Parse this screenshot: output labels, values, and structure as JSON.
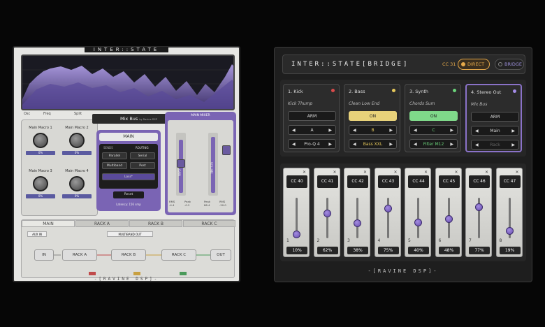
{
  "left": {
    "brand": "INTER::STATE",
    "spectrum_opts": [
      "Osc",
      "Freq",
      "Split"
    ],
    "mixbus": "Mix Bus",
    "mixbus_by": "by Ravine DSP",
    "macros": [
      "Main Macro 1",
      "Main Macro 2",
      "Main Macro 3",
      "Main Macro 4"
    ],
    "macro_vals": [
      "0%",
      "0%",
      "0%",
      "0%"
    ],
    "main_title": "MAIN",
    "mode_labels": [
      "SENDS",
      "ROUTING"
    ],
    "routing_btns": [
      "Parallel",
      "Serial",
      "Multiband",
      "Post"
    ],
    "loss_label": "Loss*",
    "reset": "Reset",
    "latency": "Latency: 156 smp",
    "mixer_title": "MAIN MIXER",
    "fader_labels": [
      "GAIN",
      "VOLUME"
    ],
    "meter_labels": [
      "RMS",
      "Peak",
      "Peak",
      "RMS"
    ],
    "meter_vals": [
      "-4.4",
      "-0.2",
      "86.4",
      "-20.0"
    ],
    "meter_knob_vals": [
      "0.0",
      "0.0"
    ],
    "tabs": [
      "MAIN",
      "RACK A",
      "RACK B",
      "RACK C"
    ],
    "main_mode": "AUX IN",
    "multiband": "MULTIBAND OUT",
    "chain": [
      "IN",
      "RACK A",
      "RACK B",
      "RACK C",
      "OUT"
    ],
    "footer": "-[RAVINE DSP]-",
    "colors": {
      "accent": "#5a5aa0",
      "purple": "#7a64b4"
    }
  },
  "right": {
    "brand": "INTER::STATE[BRIDGE]",
    "cc": "CC 31",
    "direct": "DIRECT",
    "bridge": "BRIDGE",
    "slots": [
      {
        "num_name": "1. Kick",
        "sub": "Kick Thump",
        "arm": "ARM",
        "arm_on": false,
        "mode": "A",
        "mode_color": "#ddd",
        "plugin": "Pro-Q 4",
        "plugin_color": "#ddd",
        "led": "#d94b4b"
      },
      {
        "num_name": "2. Bass",
        "sub": "Clean Low End",
        "arm": "ON",
        "arm_on": true,
        "arm_bg": "#e8d27a",
        "mode": "B",
        "mode_color": "#e6c85a",
        "plugin": "Bass XXL",
        "plugin_color": "#e6c85a",
        "led": "#e6c85a"
      },
      {
        "num_name": "3. Synth",
        "sub": "Chords Sum",
        "arm": "ON",
        "arm_on": true,
        "arm_bg": "#7fd98a",
        "mode": "C",
        "mode_color": "#6ad37a",
        "plugin": "Filter M12",
        "plugin_color": "#6ad37a",
        "led": "#6ad37a"
      },
      {
        "num_name": "4. Stereo Out",
        "sub": "Mix Bus",
        "arm": "ARM",
        "arm_on": false,
        "mode": "Main",
        "mode_color": "#ddd",
        "plugin": "Rack",
        "plugin_color": "#666",
        "led": "#a48ce8"
      }
    ],
    "faders": [
      {
        "cc": "CC 40",
        "idx": "1",
        "pct": "10%",
        "level": 0.1
      },
      {
        "cc": "CC 41",
        "idx": "2",
        "pct": "62%",
        "level": 0.62
      },
      {
        "cc": "CC 42",
        "idx": "3",
        "pct": "38%",
        "level": 0.38
      },
      {
        "cc": "CC 43",
        "idx": "4",
        "pct": "75%",
        "level": 0.75
      },
      {
        "cc": "CC 44",
        "idx": "5",
        "pct": "40%",
        "level": 0.4
      },
      {
        "cc": "CC 45",
        "idx": "6",
        "pct": "48%",
        "level": 0.48
      },
      {
        "cc": "CC 46",
        "idx": "7",
        "pct": "77%",
        "level": 0.77
      },
      {
        "cc": "CC 47",
        "idx": "8",
        "pct": "19%",
        "level": 0.19
      }
    ],
    "footer": "-[RAVINE DSP]-"
  }
}
